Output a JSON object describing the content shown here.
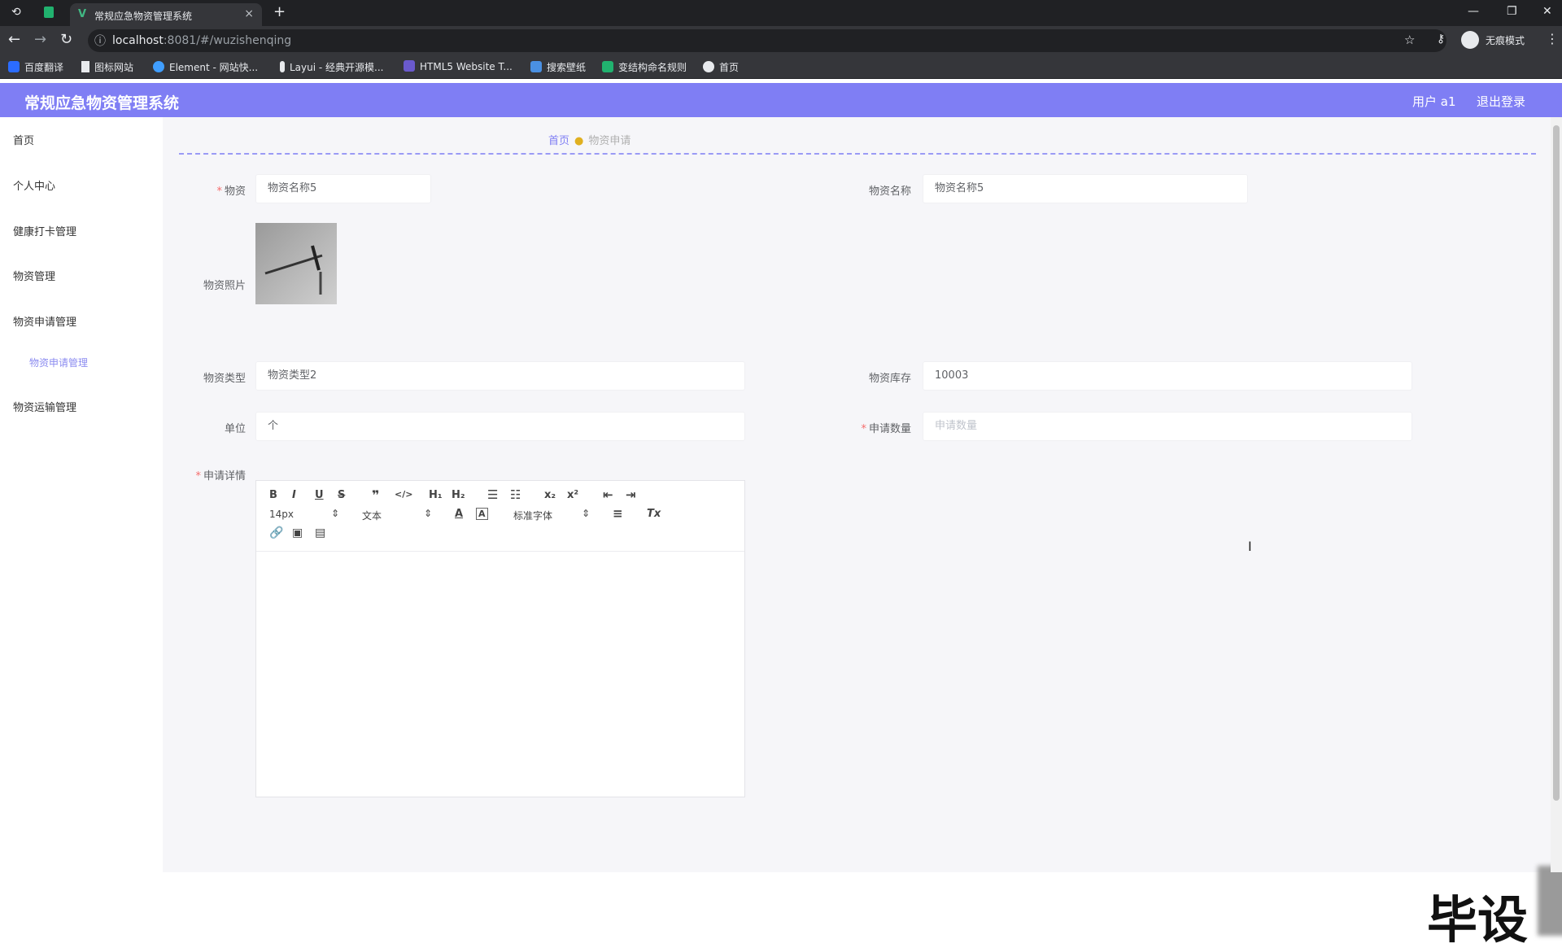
{
  "browser": {
    "tab_title": "常规应急物资管理系统",
    "tab_close": "×",
    "new_tab": "+",
    "url_host": "localhost",
    "url_rest": ":8081/#/wuzishenqing",
    "incognito_label": "无痕模式",
    "bookmarks": [
      {
        "label": "百度翻译",
        "color": "#2b6cff"
      },
      {
        "label": "图标网站",
        "color": "#e8eaed"
      },
      {
        "label": "Element - 网站快...",
        "color": "#409eff"
      },
      {
        "label": "Layui - 经典开源模...",
        "color": "#e8eaed"
      },
      {
        "label": "HTML5 Website T...",
        "color": "#6a5acd"
      },
      {
        "label": "搜索壁纸",
        "color": "#4a90e2"
      },
      {
        "label": "变结构命名规则",
        "color": "#21b26f"
      },
      {
        "label": "首页",
        "color": "#e8eaed"
      }
    ]
  },
  "header": {
    "title": "常规应急物资管理系统",
    "user": "用户 a1",
    "logout": "退出登录"
  },
  "sidebar": {
    "items": [
      {
        "label": "首页"
      },
      {
        "label": "个人中心"
      },
      {
        "label": "健康打卡管理"
      },
      {
        "label": "物资管理"
      },
      {
        "label": "物资申请管理"
      },
      {
        "label": "物资申请管理",
        "sub": true
      },
      {
        "label": "物资运输管理"
      }
    ]
  },
  "breadcrumb": {
    "home": "首页",
    "current": "物资申请"
  },
  "form": {
    "wuzi_label": "物资",
    "wuzi_value": "物资名称5",
    "name_label": "物资名称",
    "name_value": "物资名称5",
    "photo_label": "物资照片",
    "type_label": "物资类型",
    "type_value": "物资类型2",
    "stock_label": "物资库存",
    "stock_value": "10003",
    "unit_label": "单位",
    "unit_value": "个",
    "qty_label": "申请数量",
    "qty_placeholder": "申请数量",
    "detail_label": "申请详情"
  },
  "editor": {
    "font_size": "14px",
    "heading": "文本",
    "font_family": "标准字体"
  },
  "watermark": "毕设"
}
